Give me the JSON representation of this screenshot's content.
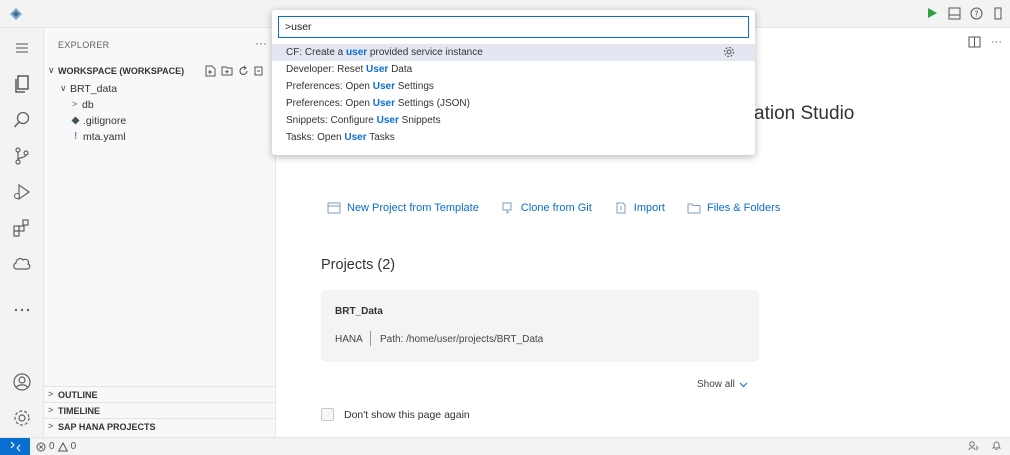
{
  "explorer": {
    "header": "EXPLORER",
    "more": "···",
    "workspace_label": "WORKSPACE (WORKSPACE)",
    "tree": [
      {
        "name": "BRT_data",
        "twisty": "∨"
      },
      {
        "name": "db",
        "twisty": ">"
      },
      {
        "name": ".gitignore"
      },
      {
        "name": "mta.yaml",
        "prefix": "!"
      }
    ],
    "sections": [
      "OUTLINE",
      "TIMELINE",
      "SAP HANA PROJECTS"
    ]
  },
  "command_palette": {
    "input_value": ">user",
    "commands": [
      {
        "before": "CF: Create a ",
        "match": "user",
        "after": " provided service instance",
        "active": true
      },
      {
        "before": "Developer: Reset ",
        "match": "User",
        "after": " Data"
      },
      {
        "before": "Preferences: Open ",
        "match": "User",
        "after": " Settings"
      },
      {
        "before": "Preferences: Open ",
        "match": "User",
        "after": " Settings (JSON)"
      },
      {
        "before": "Snippets: Configure ",
        "match": "User",
        "after": " Snippets"
      },
      {
        "before": "Tasks: Open ",
        "match": "User",
        "after": " Tasks"
      }
    ]
  },
  "welcome": {
    "title_fragment": "ation Studio",
    "quick_links": [
      "New Project from Template",
      "Clone from Git",
      "Import",
      "Files & Folders"
    ],
    "projects_title": "Projects (2)",
    "project": {
      "name": "BRT_Data",
      "type": "HANA",
      "path": "Path: /home/user/projects/BRT_Data"
    },
    "show_all": "Show all",
    "dont_show": "Don't show this page again"
  },
  "status": {
    "errors": "0",
    "warnings": "0"
  },
  "colors": {
    "accent": "#0a6ed1",
    "run_green": "#2ea043"
  }
}
